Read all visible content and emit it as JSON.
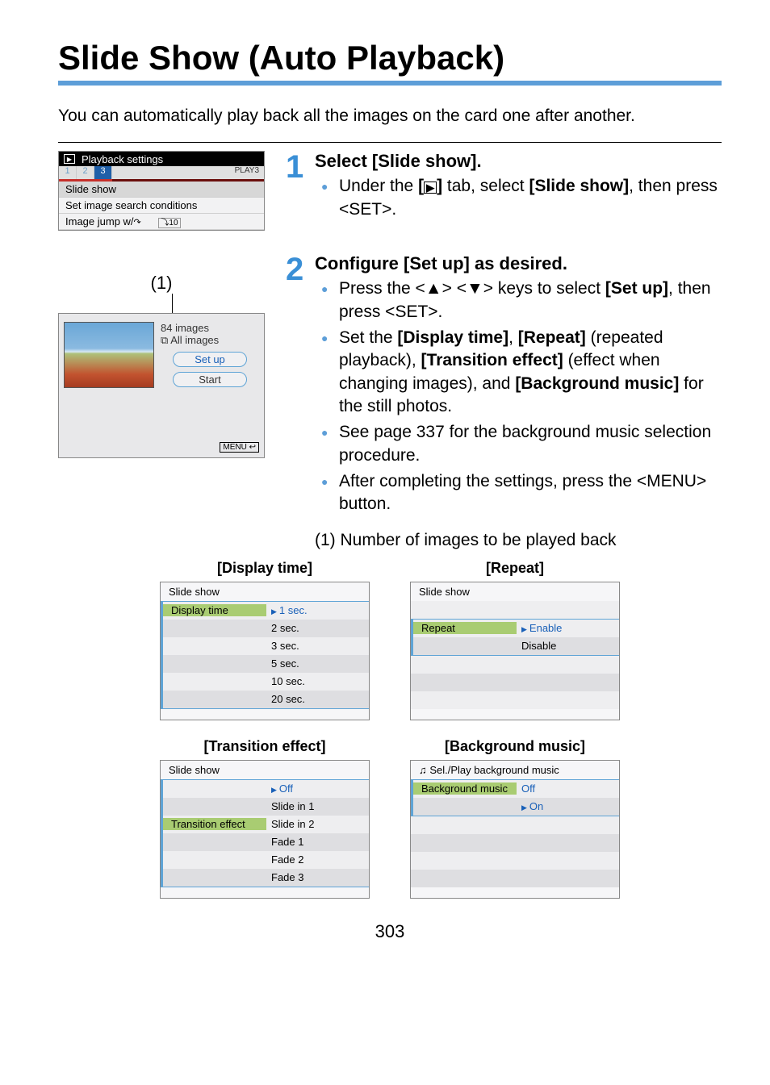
{
  "title": "Slide Show (Auto Playback)",
  "intro": "You can automatically play back all the images on the card one after another.",
  "page_number": "303",
  "step1": {
    "num": "1",
    "head": "Select [Slide show].",
    "b1_a": "Under the ",
    "b1_b": " tab, select ",
    "b1_c": "[Slide show]",
    "b1_d": ", then press <",
    "set": "SET",
    "b1_e": ">."
  },
  "step2": {
    "num": "2",
    "head": "Configure [Set up] as desired.",
    "b1": "Press the <▲> <▼> keys to select ",
    "b1b": "[Set up]",
    "b1c": ", then press <",
    "set": "SET",
    "b1d": ">.",
    "b2a": "Set the ",
    "b2b": "[Display time]",
    "b2c": ", ",
    "b2d": "[Repeat]",
    "b2e": " (repeated playback), ",
    "b2f": "[Transition effect]",
    "b2g": " (effect when changing images), and ",
    "b2h": "[Background music]",
    "b2i": " for the still photos.",
    "b3": "See page 337 for the background music selection procedure.",
    "b4a": "After completing the settings, press the <",
    "menu": "MENU",
    "b4b": "> button."
  },
  "note1": "(1) Number of images to be played back",
  "label1": "(1)",
  "shot1": {
    "title": "Playback settings",
    "tabs": [
      "1",
      "2",
      "3"
    ],
    "tablabel": "PLAY3",
    "items": [
      "Slide show",
      "Set image search conditions",
      "Image jump w/"
    ],
    "jump_icon": "↷",
    "jump_val": "⤵10"
  },
  "shot2": {
    "count": "84 images",
    "all": "All images",
    "setup": "Set up",
    "start": "Start",
    "menu": "MENU ↩"
  },
  "panels": {
    "display": {
      "cap": "[Display time]",
      "title": "Slide show",
      "label": "Display time",
      "opts": [
        "1 sec.",
        "2 sec.",
        "3 sec.",
        "5 sec.",
        "10 sec.",
        "20 sec."
      ]
    },
    "repeat": {
      "cap": "[Repeat]",
      "title": "Slide show",
      "label": "Repeat",
      "opts": [
        "Enable",
        "Disable"
      ]
    },
    "transition": {
      "cap": "[Transition effect]",
      "title": "Slide show",
      "label": "Transition effect",
      "opts": [
        "Off",
        "Slide in 1",
        "Slide in 2",
        "Fade 1",
        "Fade 2",
        "Fade 3"
      ]
    },
    "bgm": {
      "cap": "[Background music]",
      "title": "♫ Sel./Play background music",
      "label": "Background music",
      "opts": [
        "Off",
        "On"
      ]
    }
  }
}
